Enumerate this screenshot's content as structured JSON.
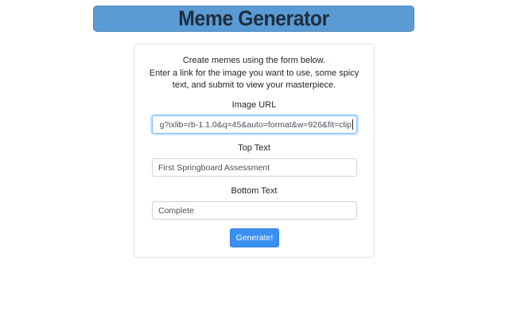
{
  "header": {
    "title": "Meme Generator"
  },
  "form": {
    "intro_lines": [
      "Create memes using the form below.",
      "Enter a link for the image you want to use, some spicy",
      "text, and submit to view your masterpiece."
    ],
    "image_url": {
      "label": "Image URL",
      "value": "g?ixlib=rb-1.1.0&q=45&auto=format&w=926&fit=clip"
    },
    "top_text": {
      "label": "Top Text",
      "value": "First Springboard Assessment"
    },
    "bottom_text": {
      "label": "Bottom Text",
      "value": "Complete"
    },
    "submit_label": "Generate!"
  },
  "colors": {
    "banner_bg": "#5b9bd5",
    "button_bg": "#3b8ff2",
    "focus_border": "#80bdff"
  }
}
